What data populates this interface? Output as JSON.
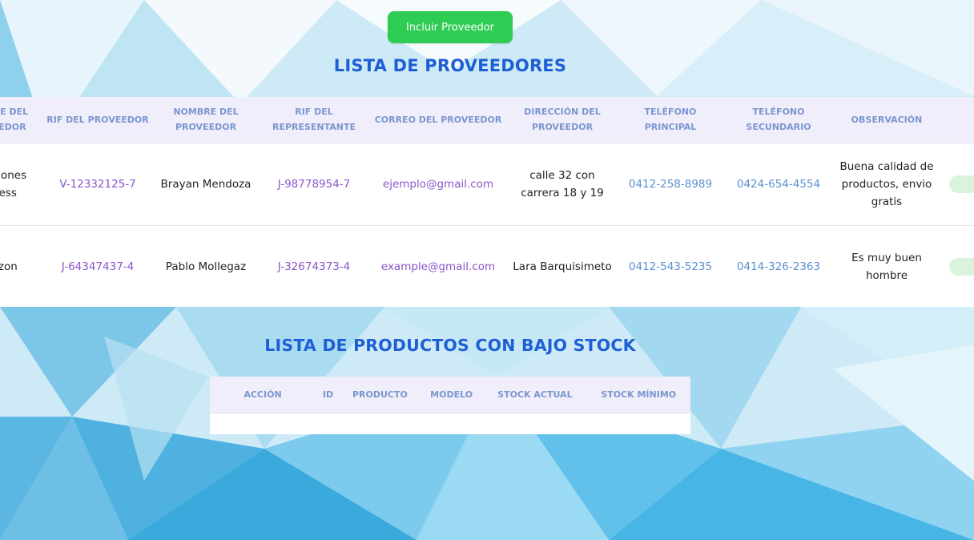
{
  "toolbar": {
    "add_supplier_label": "Incluir Proveedor"
  },
  "suppliers": {
    "title": "LISTA DE PROVEEDORES",
    "columns": [
      "NOMBRE DEL PROVEEDOR",
      "RIF DEL PROVEEDOR",
      "NOMBRE DEL PROVEEDOR",
      "RIF DEL REPRESENTANTE",
      "CORREO DEL PROVEEDOR",
      "DIRECCIÓN DEL PROVEEDOR",
      "TELÉFONO PRINCIPAL",
      "TELÉFONO SECUNDARIO",
      "OBSERVACIÓN",
      ""
    ],
    "rows": [
      {
        "company": "Inversiones Express",
        "rif": "V-12332125-7",
        "name": "Brayan Mendoza",
        "rep_rif": "J-98778954-7",
        "email": "ejemplo@gmail.com",
        "address": "calle 32 con carrera 18 y 19",
        "phone1": "0412-258-8989",
        "phone2": "0424-654-4554",
        "note": "Buena calidad de productos, envio gratis"
      },
      {
        "company": "Amazon",
        "rif": "J-64347437-4",
        "name": "Pablo Mollegaz",
        "rep_rif": "J-32674373-4",
        "email": "example@gmail.com",
        "address": "Lara Barquisimeto",
        "phone1": "0412-543-5235",
        "phone2": "0414-326-2363",
        "note": "Es muy buen hombre"
      }
    ]
  },
  "low_stock": {
    "title": "LISTA DE PRODUCTOS CON BAJO STOCK",
    "columns": [
      "ACCIÓN",
      "ID",
      "PRODUCTO",
      "MODELO",
      "STOCK ACTUAL",
      "STOCK MÍNIMO"
    ]
  },
  "colors": {
    "accent_blue": "#1f5fd6",
    "button_green": "#2ecc53",
    "header_text": "#7a96cf",
    "rif_purple": "#8b55c9",
    "phone_blue": "#5a8fd0",
    "header_bg": "#f1eefb"
  }
}
